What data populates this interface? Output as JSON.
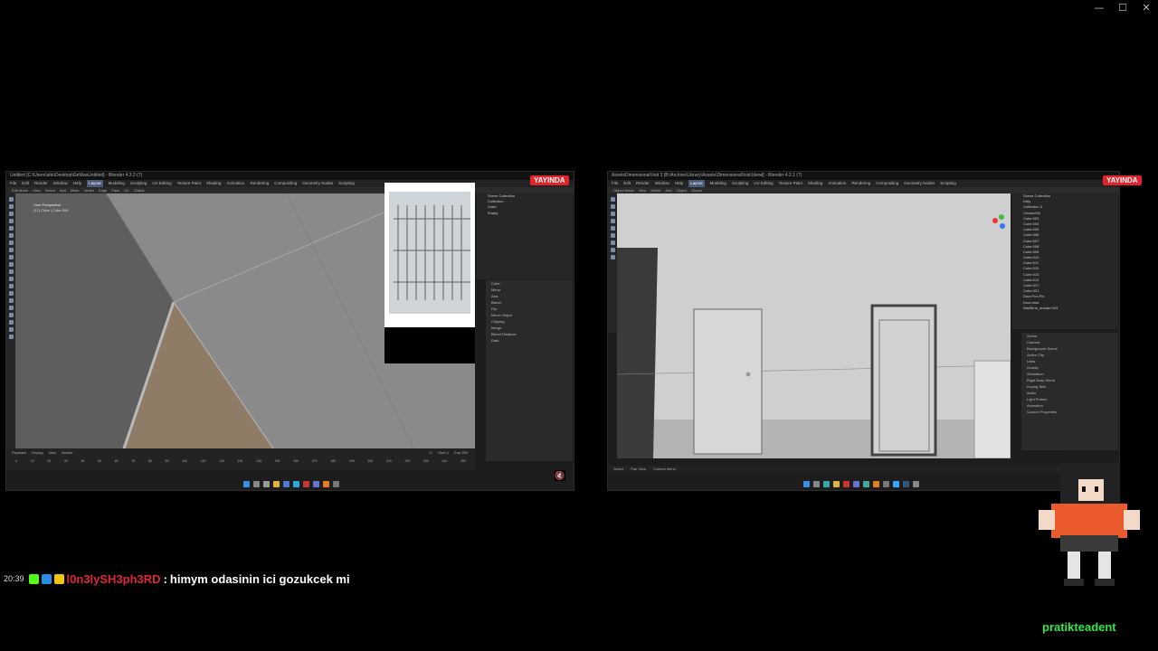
{
  "window_controls": {
    "minimize": "—",
    "maximize": "☐",
    "close": "✕"
  },
  "left_panel": {
    "title": "Untitled [C:\\Users\\ahk\\Desktop\\GeWasUntitled] - Blender 4.3.2 (7)",
    "badge": "YAYINDA",
    "menus": [
      "File",
      "Edit",
      "Render",
      "Window",
      "Help",
      "Layout",
      "Modeling",
      "Sculpting",
      "UV Editing",
      "Texture Paint",
      "Shading",
      "Animation",
      "Rendering",
      "Compositing",
      "Geometry Nodes",
      "Scripting"
    ],
    "active_menu": "Layout",
    "header": [
      "Edit Mode",
      "View",
      "Select",
      "Add",
      "Mesh",
      "Vertex",
      "Edge",
      "Face",
      "UV",
      "Global"
    ],
    "viewport_overlay": [
      "User Perspective",
      "(17) Cube | Cube.009"
    ],
    "outliner": [
      "Scene Collection",
      "Collection",
      "Cube",
      "Empty"
    ],
    "props": [
      "Cube",
      "Mirror",
      "Axis",
      "Bisect",
      "Flip",
      "Mirror Object",
      "Clipping",
      "Merge",
      "Bisect Distance",
      "Data"
    ],
    "timeline": {
      "menu": [
        "Playback",
        "Keying",
        "View",
        "Marker"
      ],
      "frame": "17",
      "start": "Start 1",
      "end": "End 250"
    },
    "ticks": [
      "0",
      "10",
      "20",
      "30",
      "40",
      "50",
      "60",
      "70",
      "80",
      "90",
      "100",
      "110",
      "120",
      "130",
      "140",
      "150",
      "160",
      "170",
      "180",
      "190",
      "200",
      "210",
      "220",
      "230",
      "240",
      "250"
    ]
  },
  "right_panel": {
    "title": "AssetsDimensionalVoid 3 [B:\\Archive\\Library\\Assets\\DimensionalVoid.blend] - Blender 4.2.1 (7)",
    "badge": "YAYINDA",
    "menus": [
      "File",
      "Edit",
      "Render",
      "Window",
      "Help",
      "Layout",
      "Modeling",
      "Sculpting",
      "UV Editing",
      "Texture Paint",
      "Shading",
      "Animation",
      "Rendering",
      "Compositing",
      "Geometry Nodes",
      "Scripting"
    ],
    "active_menu": "Layout",
    "header": [
      "Object Mode",
      "View",
      "Select",
      "Add",
      "Object",
      "Global"
    ],
    "outliner": [
      "Scene Collection",
      "Dirty",
      "Collection 3",
      "Chrsw.003",
      "Cube.003",
      "Cube.004",
      "Cube.005",
      "Cube.006",
      "Cube.007",
      "Cube.008",
      "Cube.009",
      "Cube.010",
      "Cube.011",
      "Cube.012",
      "Cube.013",
      "Cube.014",
      "Cube.017",
      "Cube.021",
      "Door.Frm.Fin",
      "Door.mod",
      "WallStrm_shader.003"
    ],
    "props": [
      "Scene",
      "Camera",
      "Background Scene",
      "Active Clip",
      "Units",
      "Gravity",
      "Simulation",
      "Rigid Body World",
      "Keying Sets",
      "Audio",
      "Light Probes",
      "Animation",
      "Custom Properties"
    ],
    "status": [
      "Select",
      "Pan View",
      "Context Menu"
    ]
  },
  "chat": {
    "time": "20:39",
    "username": "l0n3lySH3ph3RD",
    "separator": ":",
    "message": "himym odasinin ici gozukcek mi"
  },
  "channel_name": "pratikteadent",
  "colors": {
    "badge": "#e1242b",
    "username": "#e0283a",
    "channel": "#2ee84a",
    "active_menu": "#4a5a7a"
  },
  "icons": [
    "kick-badge-icon",
    "verified-badge-icon",
    "crown-badge-icon",
    "mute-icon",
    "pixel-avatar-image"
  ]
}
